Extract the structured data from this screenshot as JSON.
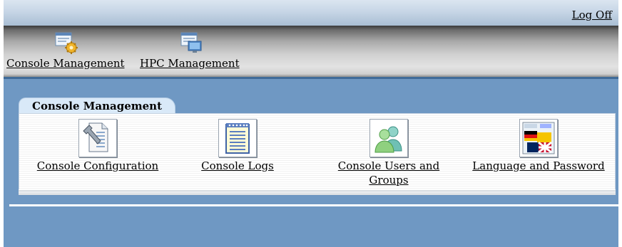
{
  "header": {
    "logoff_label": "Log Off"
  },
  "toolbar": {
    "items": [
      {
        "label": "Console Management",
        "icon": "console-management-icon"
      },
      {
        "label": "HPC Management",
        "icon": "hpc-management-icon"
      }
    ]
  },
  "main": {
    "tab_label": "Console Management",
    "items": [
      {
        "label": "Console Configuration",
        "icon": "configuration-document-wrench-icon"
      },
      {
        "label": "Console Logs",
        "icon": "notepad-logs-icon"
      },
      {
        "label": "Console Users and Groups",
        "icon": "users-groups-icon"
      },
      {
        "label": "Language and Password",
        "icon": "language-flags-icon"
      }
    ]
  },
  "colors": {
    "background_blue": "#6f98c3",
    "tab_blue": "#d9e9f8"
  }
}
